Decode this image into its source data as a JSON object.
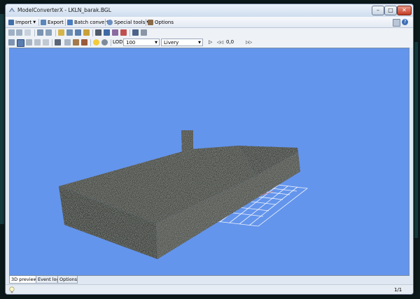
{
  "window": {
    "title": "ModelConverterX - LKLN_barak.BGL",
    "controls": {
      "minimize": "–",
      "maximize": "□",
      "close": "✕"
    }
  },
  "menu": {
    "items": [
      {
        "label": "Import",
        "icon": "import-icon",
        "dropdown": true
      },
      {
        "label": "Export",
        "icon": "export-icon",
        "dropdown": false
      },
      {
        "label": "Batch convert",
        "icon": "batch-convert-icon",
        "dropdown": false
      },
      {
        "label": "Special tools",
        "icon": "special-tools-icon",
        "dropdown": true
      },
      {
        "label": "Options",
        "icon": "options-icon",
        "dropdown": false
      }
    ],
    "right_icons": [
      "panel-icon",
      "help-icon"
    ]
  },
  "toolbar2": {
    "lod_label": "LOD",
    "lod_value": "100",
    "livery_value": "Livery",
    "play_glyph": "▷",
    "rewind_glyph": "◁◁",
    "time_value": "0,0",
    "forward_glyph": "▷▷"
  },
  "tabs": [
    "3D preview",
    "Event log",
    "Options"
  ],
  "active_tab": "3D preview",
  "status": {
    "page_counter": "1/1",
    "left_icon": "bulb-icon"
  },
  "colors": {
    "viewport_background": "#6495ec",
    "accent": "#3d6fb6"
  }
}
